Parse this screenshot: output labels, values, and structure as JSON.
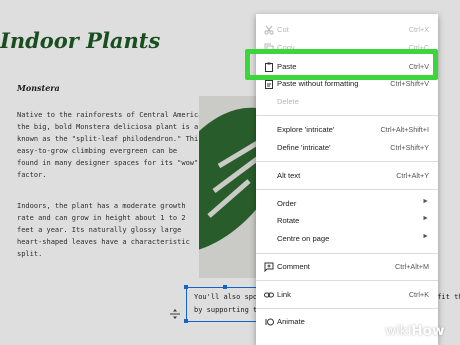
{
  "document": {
    "title": "Indoor Plants",
    "subtitle": "Monstera",
    "paragraph1": [
      "Native to the rainforests of Central America,",
      "the big, bold Monstera deliciosa plant is also",
      "known as the \"split-leaf philodendron.\" This",
      "easy-to-grow climbing evergreen can be",
      "found in many designer spaces for its \"wow\"",
      "factor."
    ],
    "paragraph2": [
      "Indoors, the plant has a moderate growth",
      "rate and can grow in height about 1 to 2",
      "feet a year. Its naturally glossy large",
      "heart-shaped leaves have a characteristic",
      "split."
    ],
    "selected_text": [
      "You'll also spot in",
      "by supporting the"
    ],
    "trailing_text": "efit the"
  },
  "context_menu": {
    "items": [
      {
        "label": "Cut",
        "shortcut": "Ctrl+X",
        "icon": "scissors-icon",
        "disabled": true
      },
      {
        "label": "Copy",
        "shortcut": "Ctrl+C",
        "icon": "copy-icon",
        "disabled": true
      },
      {
        "label": "Paste",
        "shortcut": "Ctrl+V",
        "icon": "clipboard-icon",
        "disabled": false
      },
      {
        "label": "Paste without formatting",
        "shortcut": "Ctrl+Shift+V",
        "icon": "paste-plain-icon",
        "disabled": false
      },
      {
        "label": "Delete",
        "shortcut": "",
        "icon": "",
        "disabled": true
      },
      {
        "label": "Explore 'intricate'",
        "shortcut": "Ctrl+Alt+Shift+I",
        "icon": "",
        "disabled": false
      },
      {
        "label": "Define 'intricate'",
        "shortcut": "Ctrl+Shift+Y",
        "icon": "",
        "disabled": false
      },
      {
        "label": "Alt text",
        "shortcut": "Ctrl+Alt+Y",
        "icon": "",
        "disabled": false
      },
      {
        "label": "Order",
        "shortcut": "",
        "icon": "",
        "submenu": true
      },
      {
        "label": "Rotate",
        "shortcut": "",
        "icon": "",
        "submenu": true
      },
      {
        "label": "Centre on page",
        "shortcut": "",
        "icon": "",
        "submenu": true
      },
      {
        "label": "Comment",
        "shortcut": "Ctrl+Alt+M",
        "icon": "comment-plus-icon",
        "disabled": false
      },
      {
        "label": "Link",
        "shortcut": "Ctrl+K",
        "icon": "link-icon",
        "disabled": false
      },
      {
        "label": "Animate",
        "shortcut": "",
        "icon": "animate-icon",
        "disabled": false
      }
    ],
    "highlighted_item": "Paste",
    "highlight_color": "#3dd63a"
  },
  "watermark": {
    "prefix": "wiki",
    "suffix": "How"
  },
  "colors": {
    "title": "#1d5a26",
    "selection": "#1a73e8",
    "plant_leaf": "#2f6b32"
  }
}
